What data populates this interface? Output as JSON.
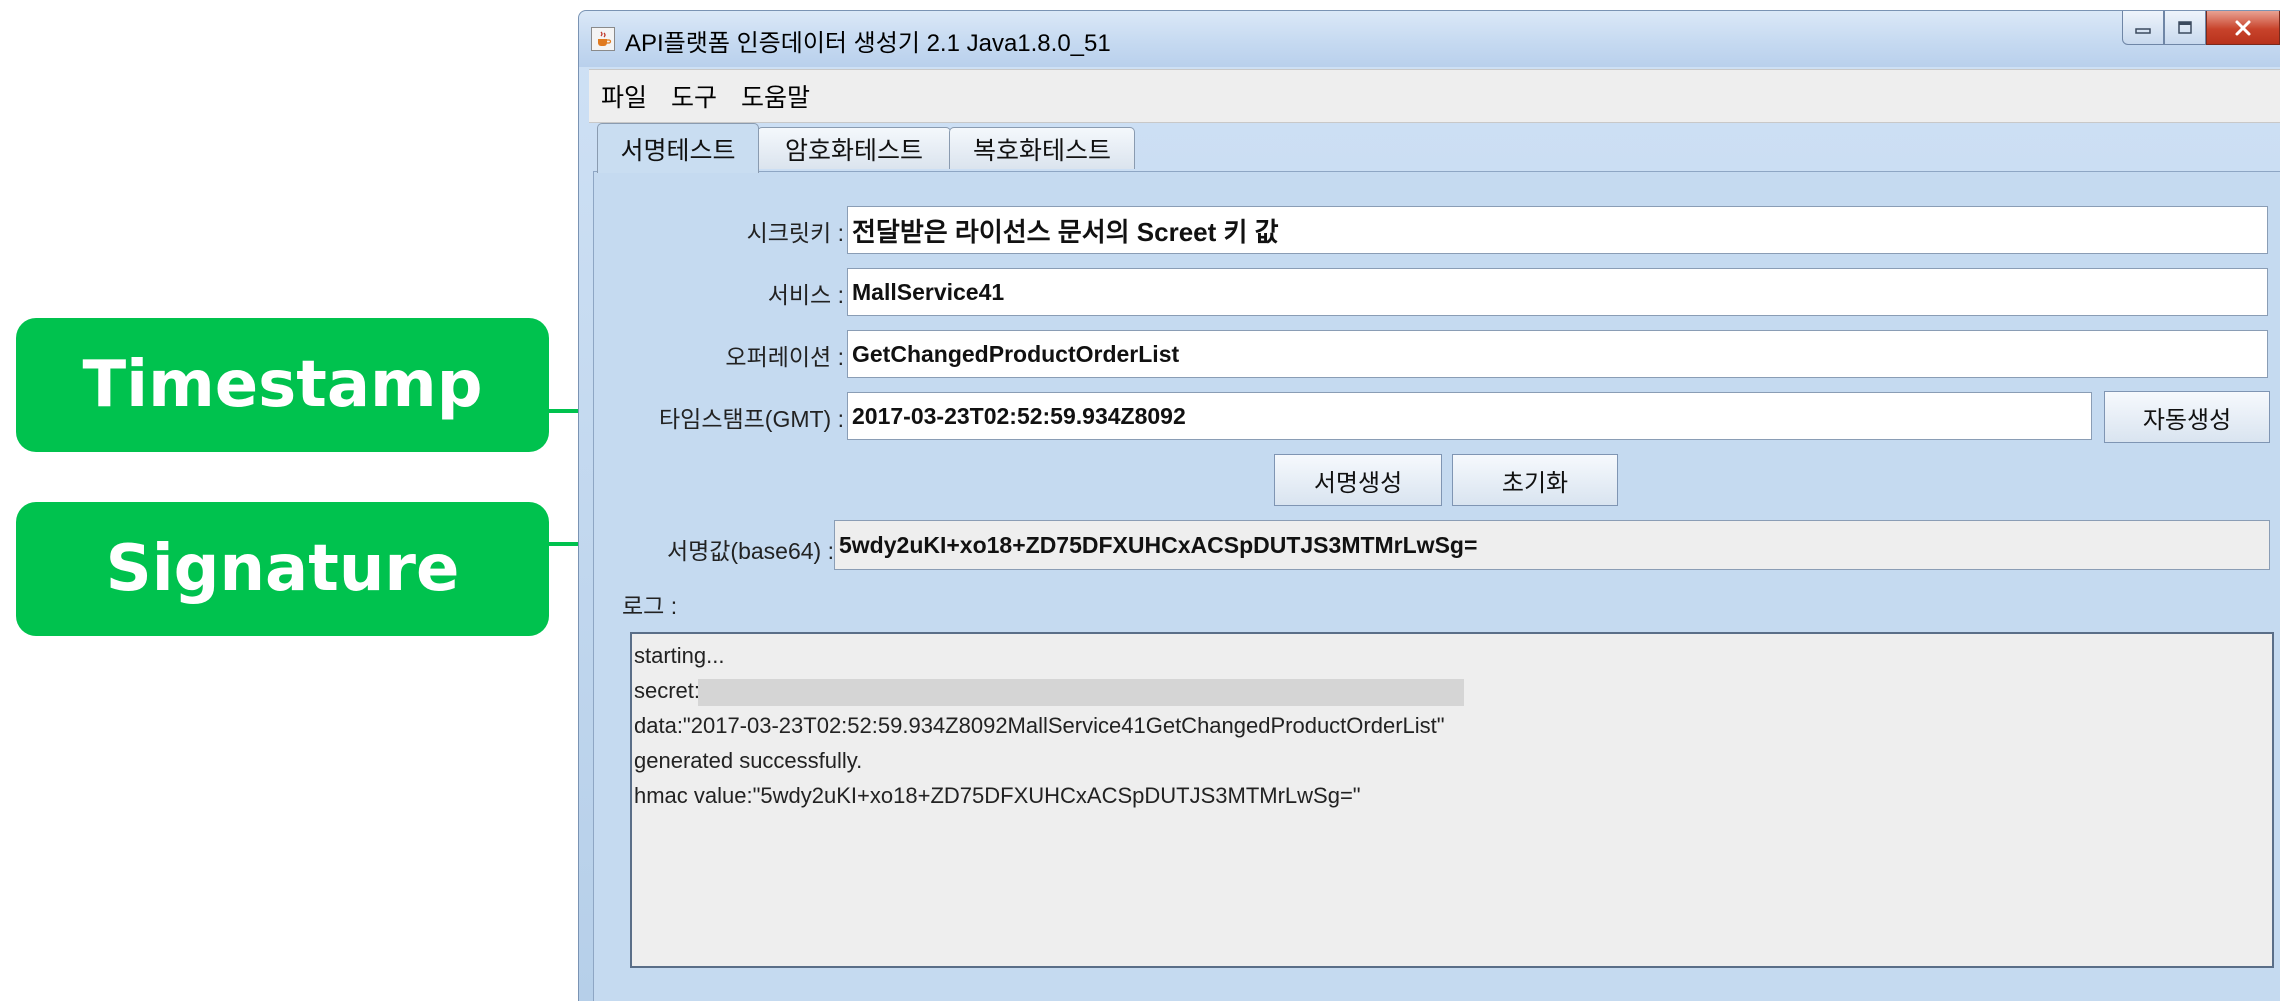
{
  "callouts": [
    {
      "label": "Timestamp"
    },
    {
      "label": "Signature"
    }
  ],
  "window": {
    "title": "API플랫폼 인증데이터 생성기 2.1 Java1.8.0_51",
    "app_icon": "java-cup-icon",
    "controls": {
      "minimize": "minimize-icon",
      "maximize": "maximize-icon",
      "close": "close-icon"
    }
  },
  "menu": {
    "items": [
      "파일",
      "도구",
      "도움말"
    ]
  },
  "tabs": {
    "items": [
      "서명테스트",
      "암호화테스트",
      "복호화테스트"
    ],
    "active": "서명테스트"
  },
  "form": {
    "secret_label": "시크릿키 :",
    "secret_value": "전달받은 라이선스 문서의 Screet 키 값",
    "service_label": "서비스 :",
    "service_value": "MallService41",
    "operation_label": "오퍼레이션 :",
    "operation_value": "GetChangedProductOrderList",
    "timestamp_label": "타임스탬프(GMT) :",
    "timestamp_value": "2017-03-23T02:52:59.934Z8092",
    "autogen_button": "자동생성",
    "sign_button": "서명생성",
    "reset_button": "초기화",
    "signature_label": "서명값(base64) :",
    "signature_value": "5wdy2uKI+xo18+ZD75DFXUHCxACSpDUTJS3MTMrLwSg=",
    "log_label": "로그 :"
  },
  "log": {
    "lines": [
      "starting...",
      "secret:",
      "data:\"2017-03-23T02:52:59.934Z8092MallService41GetChangedProductOrderList\"",
      "generated successfully.",
      "hmac value:\"5wdy2uKI+xo18+ZD75DFXUHCxACSpDUTJS3MTMrLwSg=\""
    ]
  },
  "colors": {
    "callout": "#00c24e",
    "window_frame": "#c5daf0",
    "close_button": "#c8432b"
  }
}
